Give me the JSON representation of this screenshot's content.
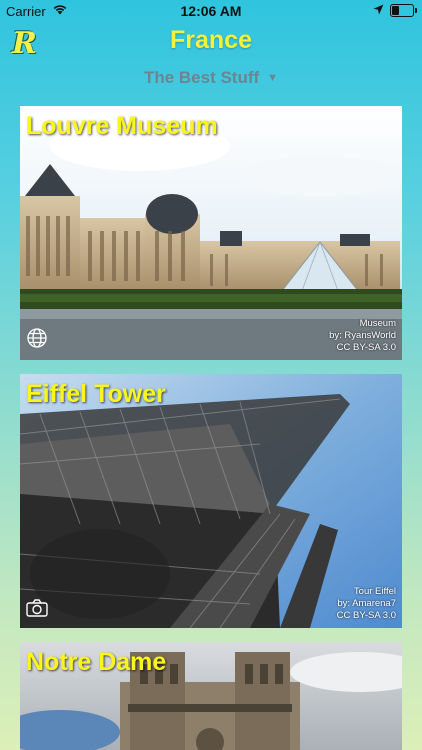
{
  "status": {
    "carrier": "Carrier",
    "time": "12:06 AM"
  },
  "header": {
    "title": "France",
    "logo": "R"
  },
  "selector": {
    "label": "The Best Stuff",
    "caret": "▼"
  },
  "cards": [
    {
      "name": "Louvre Museum",
      "credit": [
        "Museum",
        "by: RyansWorld",
        "CC BY-SA 3.0"
      ],
      "icon": "globe-icon"
    },
    {
      "name": "Eiffel Tower",
      "credit": [
        "Tour Eiffel",
        "by: Amarena7",
        "CC BY-SA 3.0"
      ],
      "icon": "camera-icon"
    },
    {
      "name": "Notre Dame"
    }
  ],
  "colors": {
    "accent": "#f4f13a",
    "card_title": "#fbf51e",
    "selector_text": "#6c8590"
  }
}
